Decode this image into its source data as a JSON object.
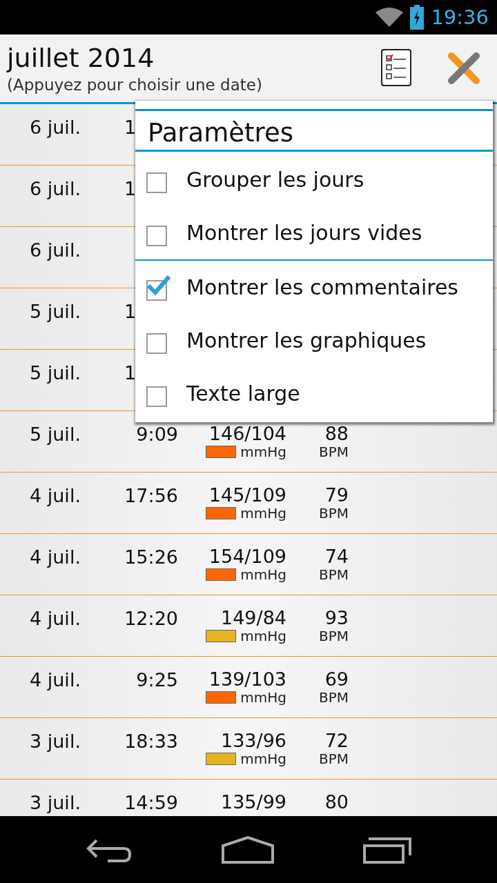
{
  "status_bar": {
    "time": "19:36"
  },
  "action_bar": {
    "title": "juillet 2014",
    "subtitle": "(Appuyez pour choisir une date)"
  },
  "rows": [
    {
      "date": "6 juil.",
      "time": "1"
    },
    {
      "date": "6 juil.",
      "time": "1"
    },
    {
      "date": "6 juil."
    },
    {
      "date": "5 juil.",
      "time": "1"
    },
    {
      "date": "5 juil.",
      "time": "1"
    },
    {
      "date": "5 juil.",
      "time": "9:09",
      "pressure": "146/104",
      "pressure_unit": "mmHg",
      "color": "#ff6600",
      "pulse": "88",
      "pulse_unit": "BPM"
    },
    {
      "date": "4 juil.",
      "time": "17:56",
      "pressure": "145/109",
      "pressure_unit": "mmHg",
      "color": "#ff6600",
      "pulse": "79",
      "pulse_unit": "BPM"
    },
    {
      "date": "4 juil.",
      "time": "15:26",
      "pressure": "154/109",
      "pressure_unit": "mmHg",
      "color": "#ff6600",
      "pulse": "74",
      "pulse_unit": "BPM"
    },
    {
      "date": "4 juil.",
      "time": "12:20",
      "pressure": "149/84",
      "pressure_unit": "mmHg",
      "color": "#e6b422",
      "pulse": "93",
      "pulse_unit": "BPM"
    },
    {
      "date": "4 juil.",
      "time": "9:25",
      "pressure": "139/103",
      "pressure_unit": "mmHg",
      "color": "#ff6600",
      "pulse": "69",
      "pulse_unit": "BPM"
    },
    {
      "date": "3 juil.",
      "time": "18:33",
      "pressure": "133/96",
      "pressure_unit": "mmHg",
      "color": "#e6b422",
      "pulse": "72",
      "pulse_unit": "BPM"
    },
    {
      "date": "3 juil.",
      "time": "14:59",
      "pressure": "135/99",
      "pulse": "80"
    }
  ],
  "menu": {
    "title": "Paramètres",
    "sections": [
      {
        "items": [
          {
            "label": "Grouper les jours",
            "checked": false
          },
          {
            "label": "Montrer les jours vides",
            "checked": false
          }
        ]
      },
      {
        "items": [
          {
            "label": "Montrer les commentaires",
            "checked": true
          },
          {
            "label": "Montrer les graphiques",
            "checked": false
          },
          {
            "label": "Texte large",
            "checked": false
          }
        ]
      }
    ]
  }
}
